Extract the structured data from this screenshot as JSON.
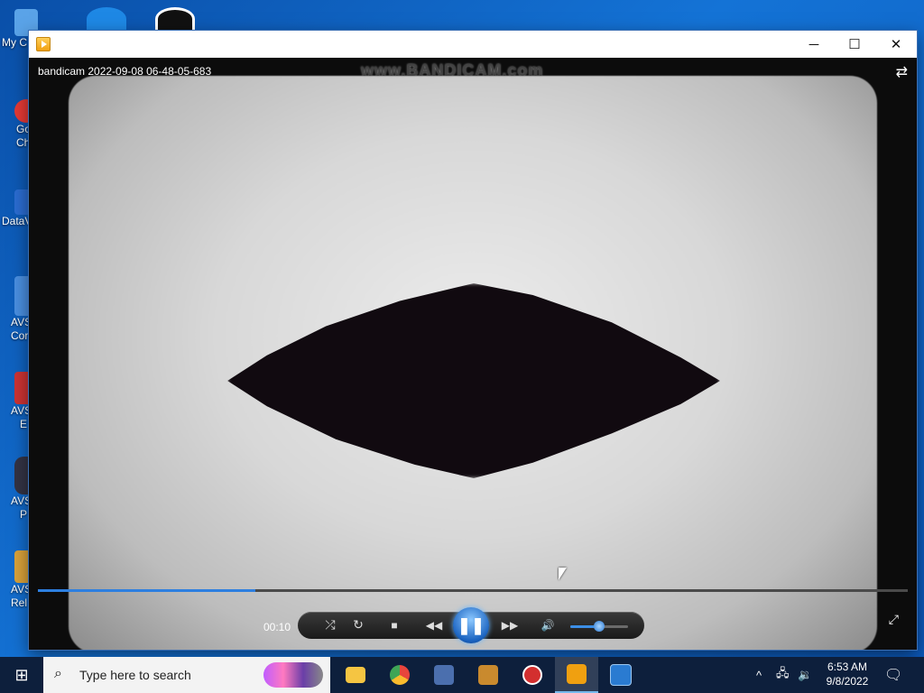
{
  "desktop": {
    "icons": [
      {
        "label": "My C",
        "color": "#5aa3e8"
      },
      {
        "label": "Go",
        "label2": "Ch",
        "color": "#e53935"
      },
      {
        "label": "DataV",
        "color": "#2b6cd1"
      },
      {
        "label": "AVS",
        "label2": "Cor",
        "color": "#4a8fe0"
      },
      {
        "label": "AVS",
        "label2": "E",
        "color": "#c33"
      },
      {
        "label": "AVS",
        "label2": "P",
        "color": "#334"
      },
      {
        "label": "AVS",
        "label2": "Rel",
        "color": "#d9a23a"
      }
    ]
  },
  "window": {
    "controls": {
      "minimize": "─",
      "maximize": "☐",
      "close": "✕"
    },
    "video_title": "bandicam 2022-09-08 06-48-05-683",
    "watermark": "www.BANDICAM.com",
    "layout_icon": "switch-layout-icon"
  },
  "player": {
    "time": "00:10",
    "progress": 0.25,
    "volume": 0.5,
    "buttons": {
      "shuffle": "⤮",
      "repeat": "↻",
      "stop": "■",
      "previous": "◀◀",
      "pause": "❚❚",
      "next": "▶▶",
      "mute": "🔊"
    },
    "fullscreen": "⤢"
  },
  "taskbar": {
    "start": "⊞",
    "search_placeholder": "Type here to search",
    "search_icon": "⌕",
    "apps": [
      {
        "name": "file-explorer",
        "color": "#f5c542"
      },
      {
        "name": "chrome",
        "color": "#e8453c"
      },
      {
        "name": "media-app",
        "color": "#4b6fae"
      },
      {
        "name": "video-editor",
        "color": "#c98a2e"
      },
      {
        "name": "bandicam",
        "color": "#d32f2f"
      },
      {
        "name": "media-player",
        "color": "#f0a010"
      },
      {
        "name": "screen-recorder",
        "color": "#2a7bd1"
      }
    ],
    "tray": {
      "chevron": "^",
      "network": "🖧",
      "volume": "🔉"
    },
    "time": "6:53 AM",
    "date": "9/8/2022",
    "notifications": "🗨"
  }
}
